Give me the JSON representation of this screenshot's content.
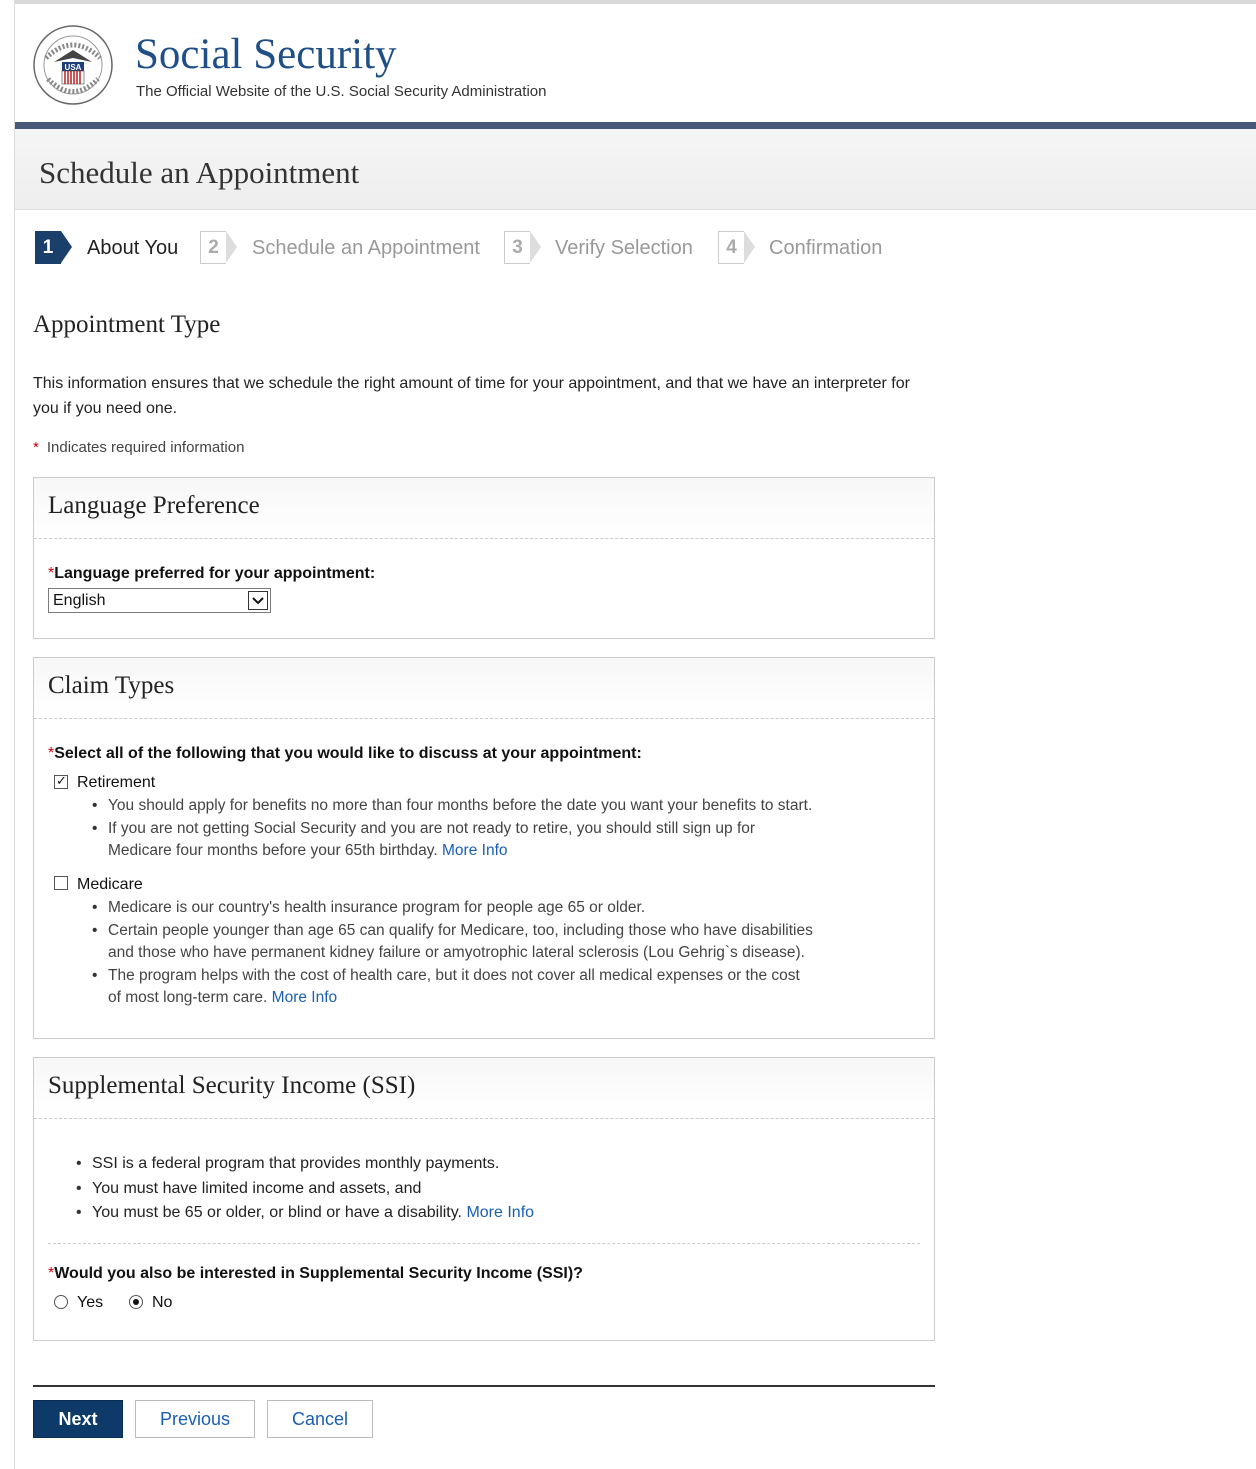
{
  "header": {
    "site_title": "Social Security",
    "site_subtitle": "The Official Website of the U.S. Social Security Administration",
    "seal_icon": "ssa-seal-icon",
    "seal_text": "SOCIAL SECURITY ADMINISTRATION USA"
  },
  "page": {
    "title": "Schedule an Appointment"
  },
  "steps": [
    {
      "num": "1",
      "label": "About You",
      "active": true
    },
    {
      "num": "2",
      "label": "Schedule an Appointment",
      "active": false
    },
    {
      "num": "3",
      "label": "Verify Selection",
      "active": false
    },
    {
      "num": "4",
      "label": "Confirmation",
      "active": false
    }
  ],
  "section": {
    "heading": "Appointment Type",
    "intro": "This information ensures that we schedule the right amount of time for your appointment, and that we have an interpreter for you if you need one.",
    "required_star": "*",
    "required_note": "Indicates required information"
  },
  "language": {
    "panel_title": "Language Preference",
    "star": "*",
    "label": "Language preferred for your appointment:",
    "selected": "English"
  },
  "claims": {
    "panel_title": "Claim Types",
    "star": "*",
    "label": "Select all of the following that you would like to discuss at your appointment:",
    "retirement": {
      "label": "Retirement",
      "checked": true,
      "bullet1": "You should apply for benefits no more than four months before the date you want your benefits to start.",
      "bullet2_line1": "If you are not getting Social Security and you are not ready to retire, you should still sign up for",
      "bullet2_line2": "Medicare four months before your 65th birthday.",
      "more_info": "More Info"
    },
    "medicare": {
      "label": "Medicare",
      "checked": false,
      "bullet1": "Medicare is our country's health insurance program for people age 65 or older.",
      "bullet2_line1": "Certain people younger than age 65 can qualify for Medicare, too, including those who have disabilities",
      "bullet2_line2": "and those who have permanent kidney failure or amyotrophic lateral sclerosis (Lou Gehrig`s disease).",
      "bullet3_line1": "The program helps with the cost of health care, but it does not cover all medical expenses or the cost",
      "bullet3_line2": "of most long-term care.",
      "more_info": "More Info"
    }
  },
  "ssi": {
    "panel_title": "Supplemental Security Income (SSI)",
    "bullet1": "SSI is a federal program that provides monthly payments.",
    "bullet2": "You must have limited income and assets, and",
    "bullet3": "You must be 65 or older, or blind or have a disability.",
    "more_info": "More Info",
    "star": "*",
    "question": "Would you also be interested in Supplemental Security Income (SSI)?",
    "yes_label": "Yes",
    "no_label": "No",
    "selected": "No"
  },
  "buttons": {
    "next": "Next",
    "previous": "Previous",
    "cancel": "Cancel"
  },
  "colors": {
    "brand_navy": "#1b3f6b",
    "link_blue": "#1a5fb4",
    "required_red": "#cc0000",
    "divider_bar": "#475979"
  }
}
